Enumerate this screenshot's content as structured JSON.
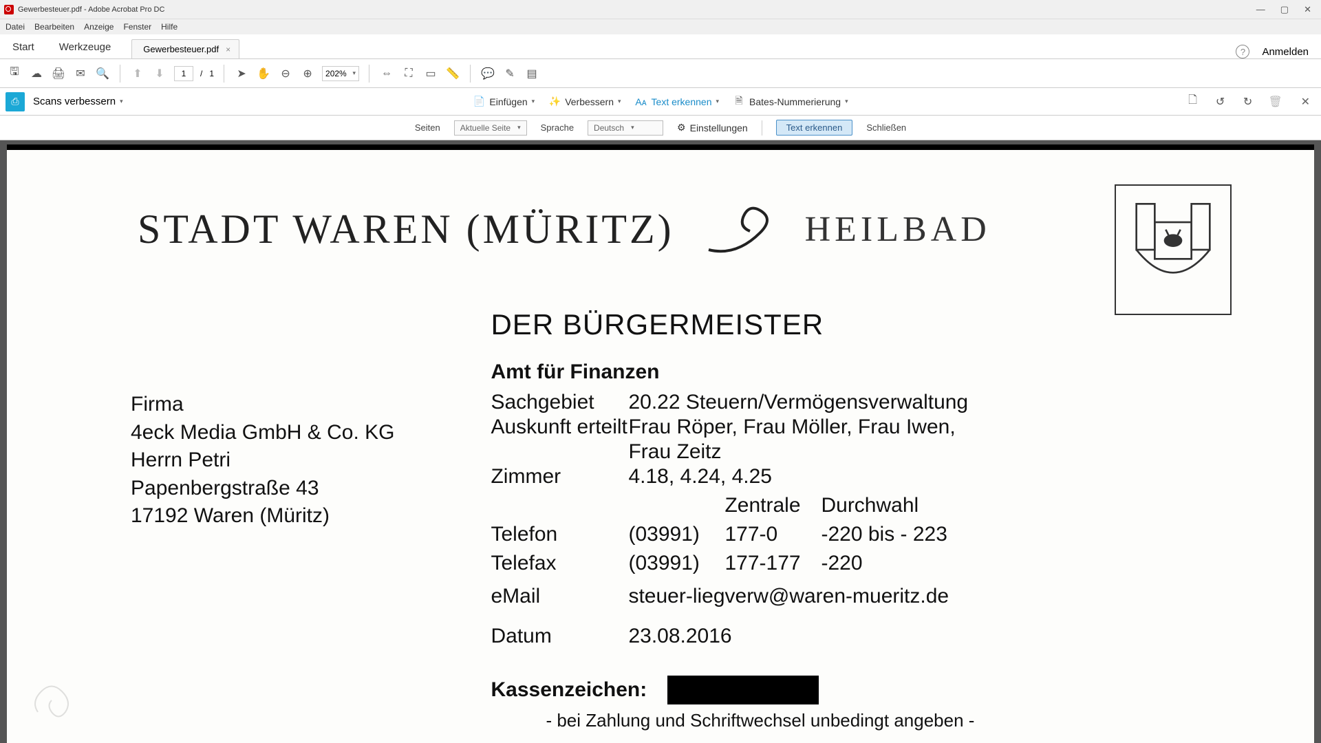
{
  "window": {
    "title": "Gewerbesteuer.pdf - Adobe Acrobat Pro DC"
  },
  "menu": {
    "datei": "Datei",
    "bearbeiten": "Bearbeiten",
    "anzeige": "Anzeige",
    "fenster": "Fenster",
    "hilfe": "Hilfe"
  },
  "tabs": {
    "start": "Start",
    "werkzeuge": "Werkzeuge",
    "doc": "Gewerbesteuer.pdf",
    "anmelden": "Anmelden"
  },
  "toolbar": {
    "page_current": "1",
    "page_sep": "/",
    "page_total": "1",
    "zoom": "202%"
  },
  "scanbar": {
    "title": "Scans verbessern",
    "einfuegen": "Einfügen",
    "verbessern": "Verbessern",
    "text_erkennen": "Text erkennen",
    "bates": "Bates-Nummerierung"
  },
  "optbar": {
    "seiten": "Seiten",
    "seiten_val": "Aktuelle Seite",
    "sprache": "Sprache",
    "sprache_val": "Deutsch",
    "einstellungen": "Einstellungen",
    "btn": "Text erkennen",
    "schliessen": "Schließen"
  },
  "doc": {
    "city": "STADT WAREN (MÜRITZ)",
    "heilbad": "HEILBAD",
    "buergermeister": "DER BÜRGERMEISTER",
    "amt": "Amt für Finanzen",
    "addr": {
      "l1": "Firma",
      "l2": "4eck Media GmbH & Co. KG",
      "l3": "Herrn Petri",
      "l4": "Papenbergstraße 43",
      "l5": "17192 Waren (Müritz)"
    },
    "info": {
      "sachgebiet_l": "Sachgebiet",
      "sachgebiet_v": "20.22  Steuern/Vermögensverwaltung",
      "auskunft_l": "Auskunft erteilt",
      "auskunft_v": "Frau Röper, Frau Möller, Frau Iwen,",
      "auskunft_v2": "Frau Zeitz",
      "zimmer_l": "Zimmer",
      "zimmer_v": "4.18, 4.24, 4.25",
      "zentrale": "Zentrale",
      "durchwahl": "Durchwahl",
      "telefon_l": "Telefon",
      "telefon_c1": "(03991)",
      "telefon_c2": "177-0",
      "telefon_c3": "-220 bis - 223",
      "telefax_l": "Telefax",
      "telefax_c1": "(03991)",
      "telefax_c2": "177-177",
      "telefax_c3": "-220",
      "email_l": "eMail",
      "email_v": "steuer-liegverw@waren-mueritz.de",
      "datum_l": "Datum",
      "datum_v": "23.08.2016",
      "kz_l": "Kassenzeichen:",
      "kz_note": "- bei Zahlung und Schriftwechsel unbedingt angeben -"
    }
  }
}
